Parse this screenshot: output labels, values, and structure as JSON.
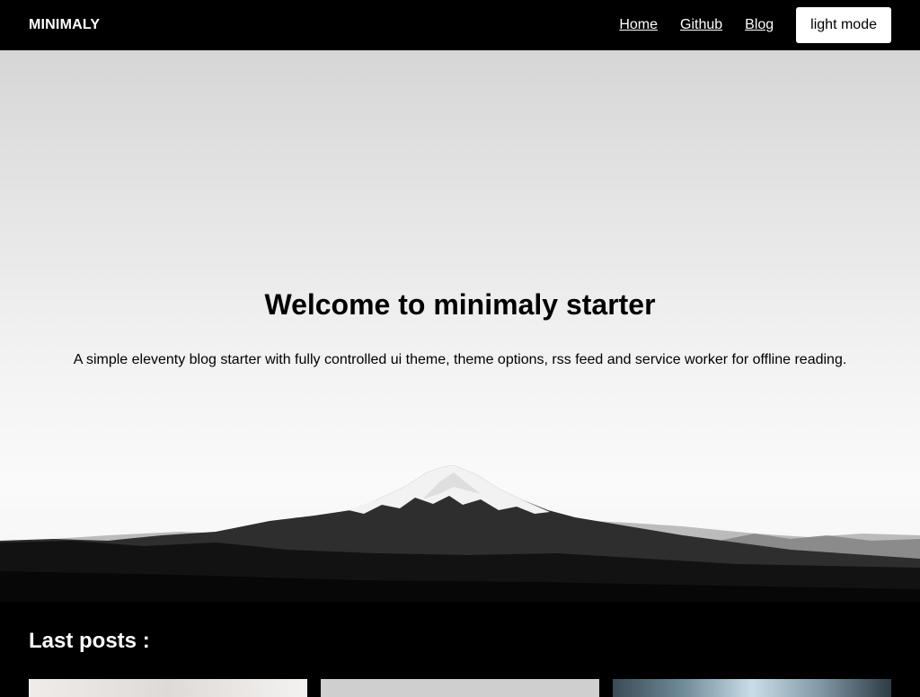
{
  "navbar": {
    "brand": "MINIMALY",
    "links": [
      {
        "label": "Home"
      },
      {
        "label": "Github"
      },
      {
        "label": "Blog"
      }
    ],
    "theme_button_label": "light mode"
  },
  "hero": {
    "title": "Welcome to minimaly starter",
    "subtitle": "A simple eleventy blog starter with fully controlled ui theme, theme options, rss feed and service worker for offline reading."
  },
  "posts": {
    "heading": "Last posts :"
  }
}
